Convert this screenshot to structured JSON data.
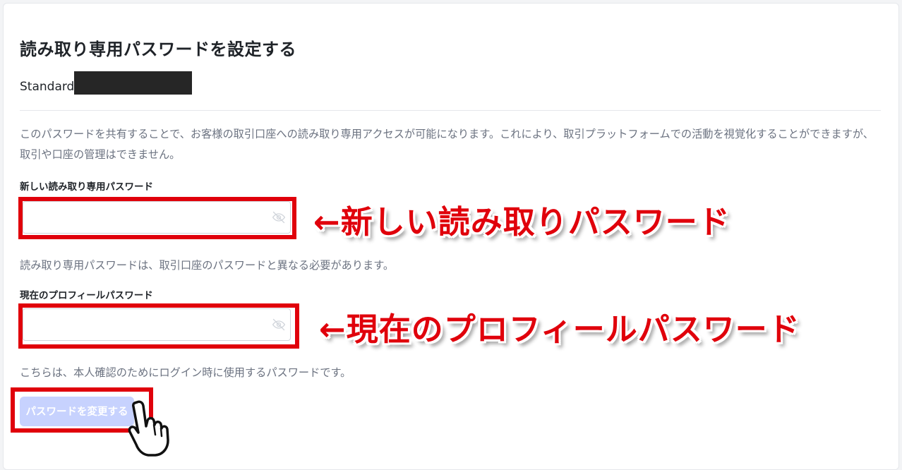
{
  "page": {
    "title": "読み取り専用パスワードを設定する",
    "account_type": "Standard",
    "description": "このパスワードを共有することで、お客様の取引口座への読み取り専用アクセスが可能になります。これにより、取引プラットフォームでの活動を視覚化することができますが、取引や口座の管理はできません。"
  },
  "form": {
    "new_password": {
      "label": "新しい読み取り専用パスワード",
      "value": "",
      "hint": "読み取り専用パスワードは、取引口座のパスワードと異なる必要があります。",
      "icon": "eye-off-icon"
    },
    "current_password": {
      "label": "現在のプロフィールパスワード",
      "value": "",
      "hint": "こちらは、本人確認のためにログイン時に使用するパスワードです。",
      "icon": "eye-off-icon"
    },
    "submit_label": "パスワードを変更する"
  },
  "annotations": {
    "new_password_callout": "←新しい読み取りパスワード",
    "current_password_callout": "←現在のプロフィールパスワード",
    "pointer_icon": "hand-pointer-icon"
  },
  "colors": {
    "highlight": "#e0000b",
    "button_disabled": "#c7d2fe",
    "muted_text": "#6b7280",
    "heading_text": "#1f2328"
  }
}
